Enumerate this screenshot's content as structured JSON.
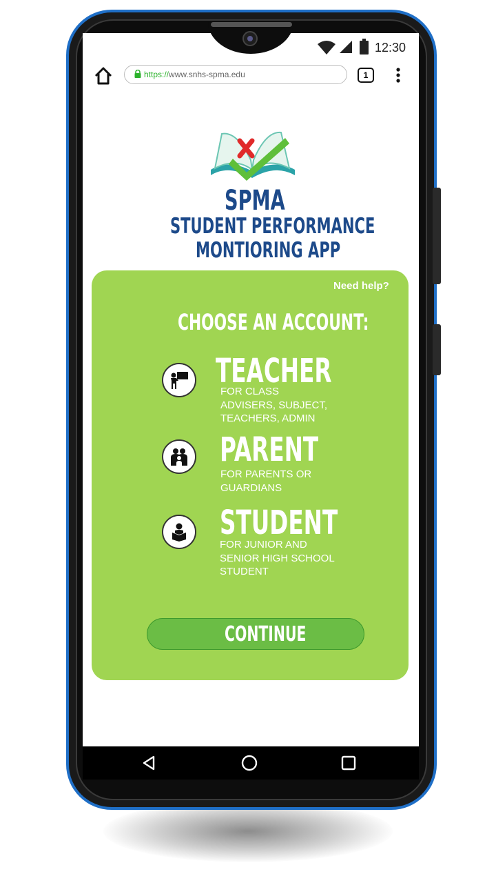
{
  "status_bar": {
    "time": "12:30"
  },
  "browser": {
    "url_scheme": "https://",
    "url_rest": "www.snhs-spma.edu",
    "tab_count": "1"
  },
  "logo": {
    "title": "SPMA",
    "subtitle_line1": "STUDENT PERFORMANCE",
    "subtitle_line2": "MONTIORING APP"
  },
  "card": {
    "help_link": "Need help?",
    "heading": "CHOOSE AN ACCOUNT:",
    "accounts": [
      {
        "label": "TEACHER",
        "desc": [
          "FOR CLASS",
          "ADVISERS, SUBJECT,",
          "TEACHERS, ADMIN"
        ],
        "icon": "teacher-icon"
      },
      {
        "label": "PARENT",
        "desc": [
          "FOR PARENTS OR",
          "GUARDIANS"
        ],
        "icon": "parent-icon"
      },
      {
        "label": "STUDENT",
        "desc": [
          "FOR JUNIOR AND",
          "SENIOR HIGH SCHOOL",
          "STUDENT"
        ],
        "icon": "student-icon"
      }
    ],
    "continue_label": "CONTINUE"
  },
  "colors": {
    "card": "#a0d552",
    "button": "#6bbd45",
    "title_blue": "#1d4a8a",
    "phone_frame": "#1f6fc7"
  }
}
